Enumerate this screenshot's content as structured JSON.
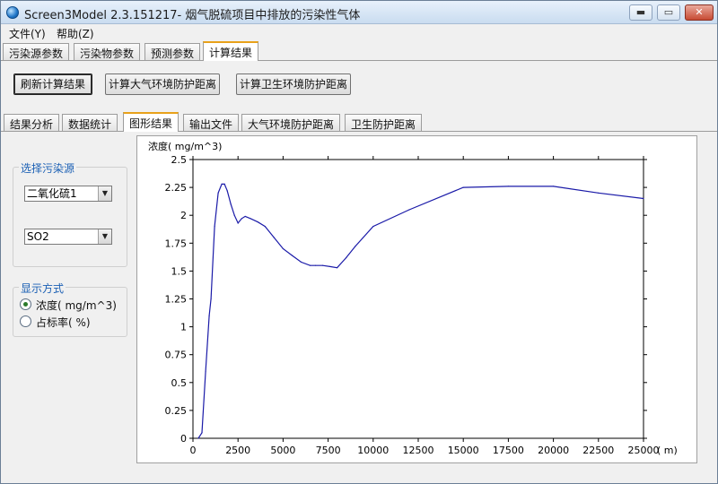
{
  "window": {
    "title": "Screen3Model 2.3.151217- 烟气脱硫项目中排放的污染性气体",
    "controls": {
      "minimize": "▬",
      "maximize": "▭",
      "close": "✕"
    }
  },
  "menu": {
    "file": "文件(Y)",
    "help": "帮助(Z)"
  },
  "main_tabs": [
    {
      "label": "污染源参数"
    },
    {
      "label": "污染物参数"
    },
    {
      "label": "预测参数"
    },
    {
      "label": "计算结果"
    }
  ],
  "actions": {
    "refresh": "刷新计算结果",
    "atmos": "计算大气环境防护距离",
    "sanitary": "计算卫生环境防护距离"
  },
  "sub_tabs": [
    {
      "label": "结果分析"
    },
    {
      "label": "数据统计"
    },
    {
      "label": "图形结果"
    },
    {
      "label": "输出文件"
    },
    {
      "label": "大气环境防护距离"
    },
    {
      "label": "卫生防护距离"
    }
  ],
  "source_group": {
    "title": "选择污染源",
    "source_value": "二氧化硫1",
    "pollutant_value": "SO2"
  },
  "display_group": {
    "title": "显示方式",
    "options": [
      {
        "label": "浓度( mg/m^3)",
        "checked": true
      },
      {
        "label": "占标率( %)",
        "checked": false
      }
    ]
  },
  "colors": {
    "line": "#1a1aa8",
    "tab_accent": "#e8a11a",
    "group_title": "#1a5fb4"
  },
  "chart_data": {
    "type": "line",
    "ylabel": "浓度( mg/m^3)",
    "xlabel": "( m)",
    "xlim": [
      0,
      25000
    ],
    "ylim": [
      0,
      2.5
    ],
    "x_ticks": [
      "0",
      "2500",
      "5000",
      "7500",
      "10000",
      "12500",
      "15000",
      "17500",
      "20000",
      "22500",
      "25000"
    ],
    "y_ticks": [
      "0",
      "0.25",
      "0.5",
      "0.75",
      "1",
      "1.25",
      "1.5",
      "1.75",
      "2",
      "2.25",
      "2.5"
    ],
    "grid": false,
    "series": [
      {
        "x": [
          300,
          500,
          700,
          900,
          1000,
          1200,
          1400,
          1600,
          1750,
          1900,
          2100,
          2300,
          2500,
          2700,
          2900,
          3200,
          3600,
          4000,
          4500,
          5000,
          5500,
          6000,
          6500,
          6800,
          7200,
          7600,
          8000,
          8500,
          9000,
          10000,
          12000,
          15000,
          17500,
          20000,
          22500,
          25000
        ],
        "y": [
          0,
          0.05,
          0.6,
          1.1,
          1.25,
          1.9,
          2.2,
          2.28,
          2.28,
          2.22,
          2.1,
          2.0,
          1.93,
          1.97,
          1.99,
          1.97,
          1.94,
          1.9,
          1.8,
          1.7,
          1.64,
          1.58,
          1.55,
          1.55,
          1.55,
          1.54,
          1.53,
          1.62,
          1.72,
          1.9,
          2.05,
          2.25,
          2.26,
          2.26,
          2.2,
          2.15
        ]
      }
    ]
  }
}
